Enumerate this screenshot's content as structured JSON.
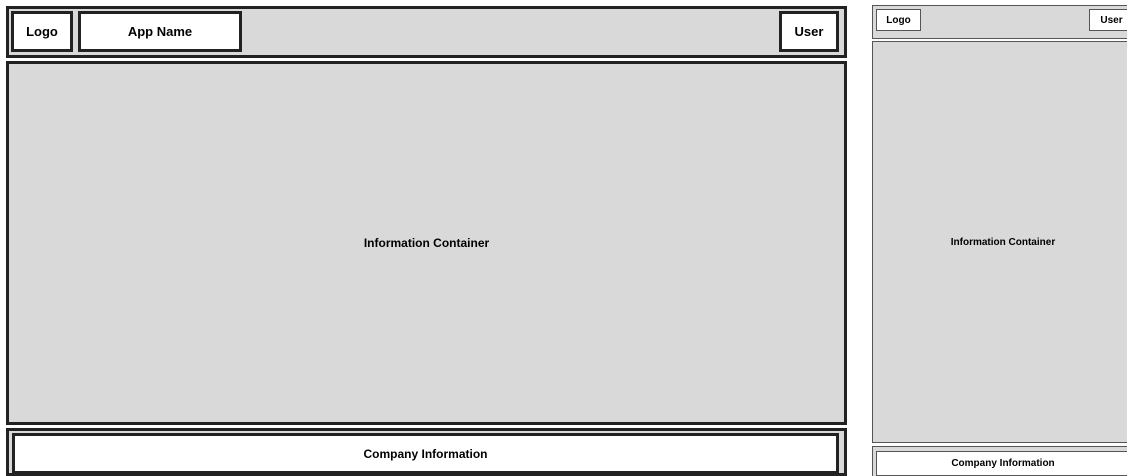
{
  "desktop": {
    "header": {
      "logo": "Logo",
      "app_name": "App Name",
      "user": "User"
    },
    "main": {
      "label": "Information Container"
    },
    "footer": {
      "label": "Company Information"
    }
  },
  "mobile": {
    "header": {
      "logo": "Logo",
      "user": "User"
    },
    "main": {
      "label": "Information Container"
    },
    "footer": {
      "label": "Company Information"
    }
  },
  "colors": {
    "container_fill": "#d9d9d9",
    "box_fill": "#ffffff",
    "border": "#222222"
  }
}
